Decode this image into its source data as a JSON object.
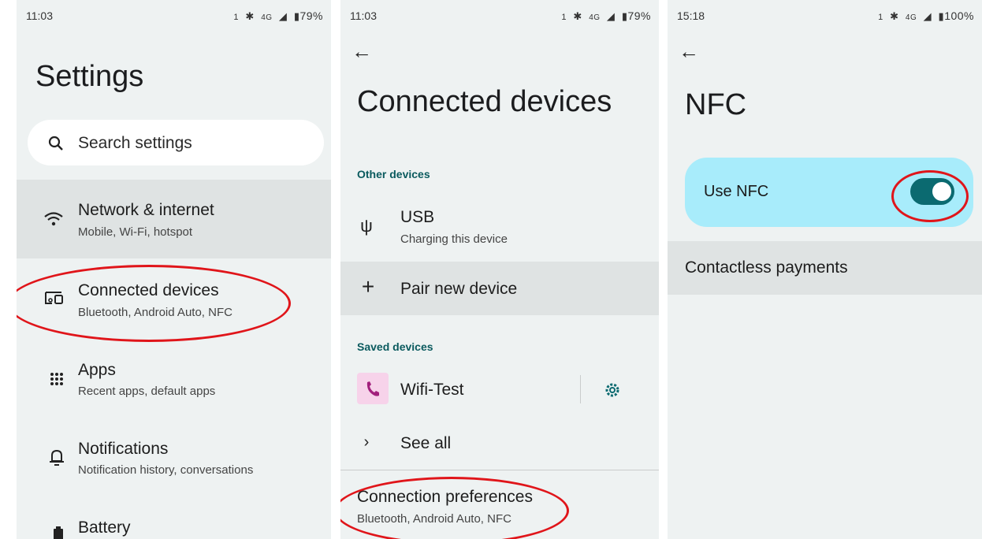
{
  "panel1": {
    "status": {
      "time": "11:03",
      "sim": "1",
      "network": "4G",
      "battery": "79%"
    },
    "title": "Settings",
    "search": {
      "placeholder": "Search settings",
      "icon": "search-icon"
    },
    "items": [
      {
        "title": "Network & internet",
        "subtitle": "Mobile, Wi-Fi, hotspot",
        "icon": "wifi-icon"
      },
      {
        "title": "Connected devices",
        "subtitle": "Bluetooth, Android Auto, NFC",
        "icon": "devices-icon"
      },
      {
        "title": "Apps",
        "subtitle": "Recent apps, default apps",
        "icon": "apps-grid-icon"
      },
      {
        "title": "Notifications",
        "subtitle": "Notification history, conversations",
        "icon": "bell-icon"
      },
      {
        "title": "Battery",
        "subtitle": "",
        "icon": "battery-icon"
      }
    ]
  },
  "panel2": {
    "status": {
      "time": "11:03",
      "sim": "1",
      "network": "4G",
      "battery": "79%"
    },
    "title": "Connected devices",
    "other_devices_header": "Other devices",
    "usb": {
      "title": "USB",
      "subtitle": "Charging this device"
    },
    "pair_new": "Pair new device",
    "saved_devices_header": "Saved devices",
    "saved_device": "Wifi-Test",
    "see_all": "See all",
    "connection_prefs": {
      "title": "Connection preferences",
      "subtitle": "Bluetooth, Android Auto, NFC"
    }
  },
  "panel3": {
    "status": {
      "time": "15:18",
      "sim": "1",
      "network": "4G",
      "battery": "100%"
    },
    "title": "NFC",
    "use_nfc": "Use NFC",
    "use_nfc_on": true,
    "contactless": "Contactless payments"
  },
  "colors": {
    "accent": "#0b6a70",
    "highlight_ring": "#e0151a",
    "nfc_card": "#a8ecfb"
  }
}
